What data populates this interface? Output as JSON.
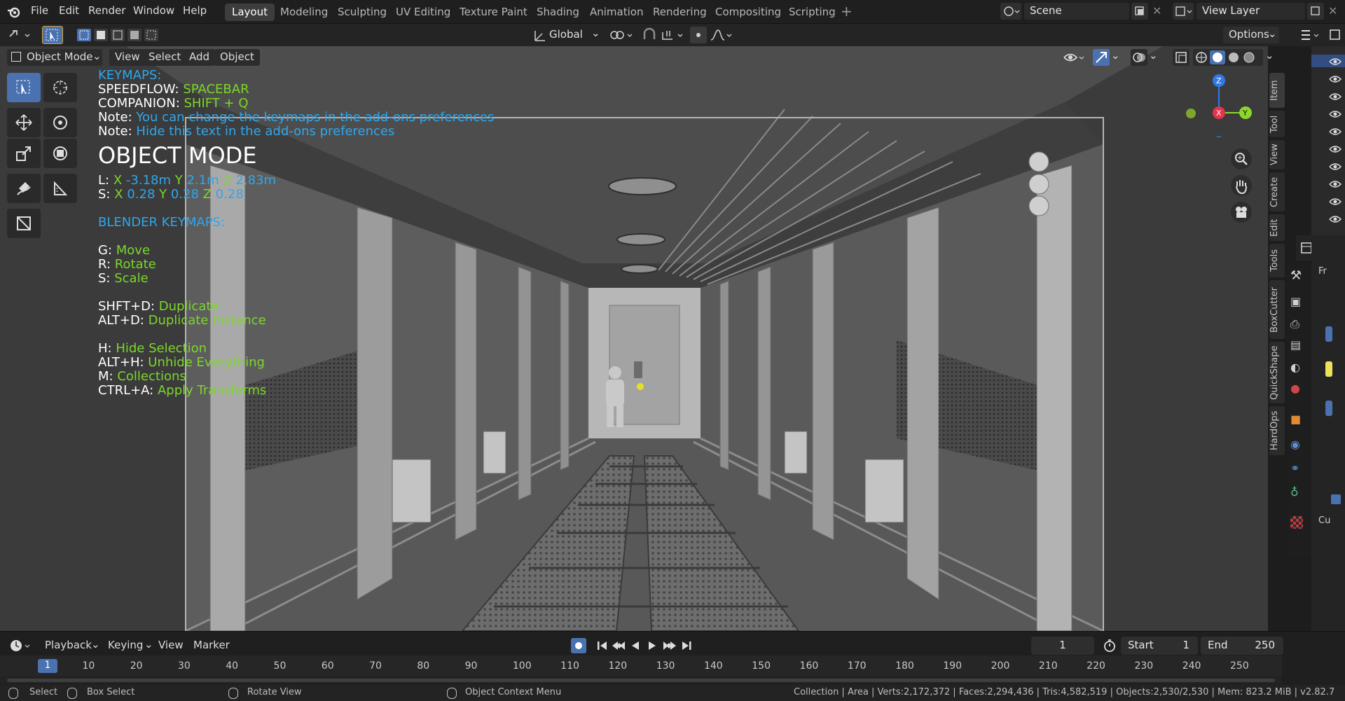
{
  "menu": [
    "File",
    "Edit",
    "Render",
    "Window",
    "Help"
  ],
  "workspaces": [
    "Layout",
    "Modeling",
    "Sculpting",
    "UV Editing",
    "Texture Paint",
    "Shading",
    "Animation",
    "Rendering",
    "Compositing",
    "Scripting"
  ],
  "active_workspace": "Layout",
  "scene_name": "Scene",
  "view_layer": "View Layer",
  "transform_orientation": "Global",
  "options_label": "Options",
  "mode": "Object Mode",
  "viewport_menu": [
    "View",
    "Select",
    "Add",
    "Object"
  ],
  "overlay": {
    "keymaps_title": "KEYMAPS:",
    "speedflow_label": "SPEEDFLOW:",
    "speedflow_key": "SPACEBAR",
    "companion_label": "COMPANION:",
    "companion_key": "SHIFT + Q",
    "note_label": "Note:",
    "note1": "You can change the keymaps in the add-ons preferences",
    "note2": "Hide this text in the add-ons preferences",
    "mode_title": "OBJECT MODE",
    "loc_label": "L:",
    "loc_x_label": "X",
    "loc_x": "-3.18m",
    "loc_y_label": "Y",
    "loc_y": "2.1m",
    "loc_z_label": "Z",
    "loc_z": "2.83m",
    "scale_label": "S:",
    "scale_x": "0.28",
    "scale_y": "0.28",
    "scale_z": "0.28",
    "blender_keymaps_title": "BLENDER KEYMAPS:",
    "keymaps": [
      {
        "key": "G:",
        "action": "Move"
      },
      {
        "key": "R:",
        "action": "Rotate"
      },
      {
        "key": "S:",
        "action": "Scale"
      },
      {
        "key": "SHFT+D:",
        "action": "Duplicate"
      },
      {
        "key": "ALT+D:",
        "action": "Duplicate Instance"
      },
      {
        "key": "H:",
        "action": "Hide Selection"
      },
      {
        "key": "ALT+H:",
        "action": "Unhide Everything"
      },
      {
        "key": "M:",
        "action": "Collections"
      },
      {
        "key": "CTRL+A:",
        "action": "Apply Transforms"
      }
    ]
  },
  "gizmo": {
    "x": "X",
    "y": "Y",
    "z": "Z"
  },
  "sidebar_tabs": [
    "Item",
    "Tool",
    "View",
    "Create",
    "Edit",
    "Tools",
    "BoxCutter",
    "QuickShape",
    "HardOps"
  ],
  "props_fragments": [
    "Fr",
    "Cu"
  ],
  "timeline": {
    "menu": [
      "Playback",
      "Keying",
      "View",
      "Marker"
    ],
    "current_frame": "1",
    "start_label": "Start",
    "start": "1",
    "end_label": "End",
    "end": "250",
    "ruler_ticks": [
      "1",
      "10",
      "20",
      "30",
      "40",
      "50",
      "60",
      "70",
      "80",
      "90",
      "100",
      "110",
      "120",
      "130",
      "140",
      "150",
      "160",
      "170",
      "180",
      "190",
      "200",
      "210",
      "220",
      "230",
      "240",
      "250"
    ]
  },
  "status": {
    "select": "Select",
    "box_select": "Box Select",
    "rotate_view": "Rotate View",
    "context_menu": "Object Context Menu",
    "stats": "Collection | Area | Verts:2,172,372 | Faces:2,294,436 | Tris:4,582,519 | Objects:2,530/2,530 | Mem: 823.2 MiB | v2.82.7"
  },
  "colors": {
    "accent": "#4a72b0",
    "overlay_blue": "#2ea7ec",
    "overlay_green": "#7bd828",
    "axis_x": "#e2344a",
    "axis_y": "#8bd72a",
    "axis_z": "#2f7ae8"
  }
}
